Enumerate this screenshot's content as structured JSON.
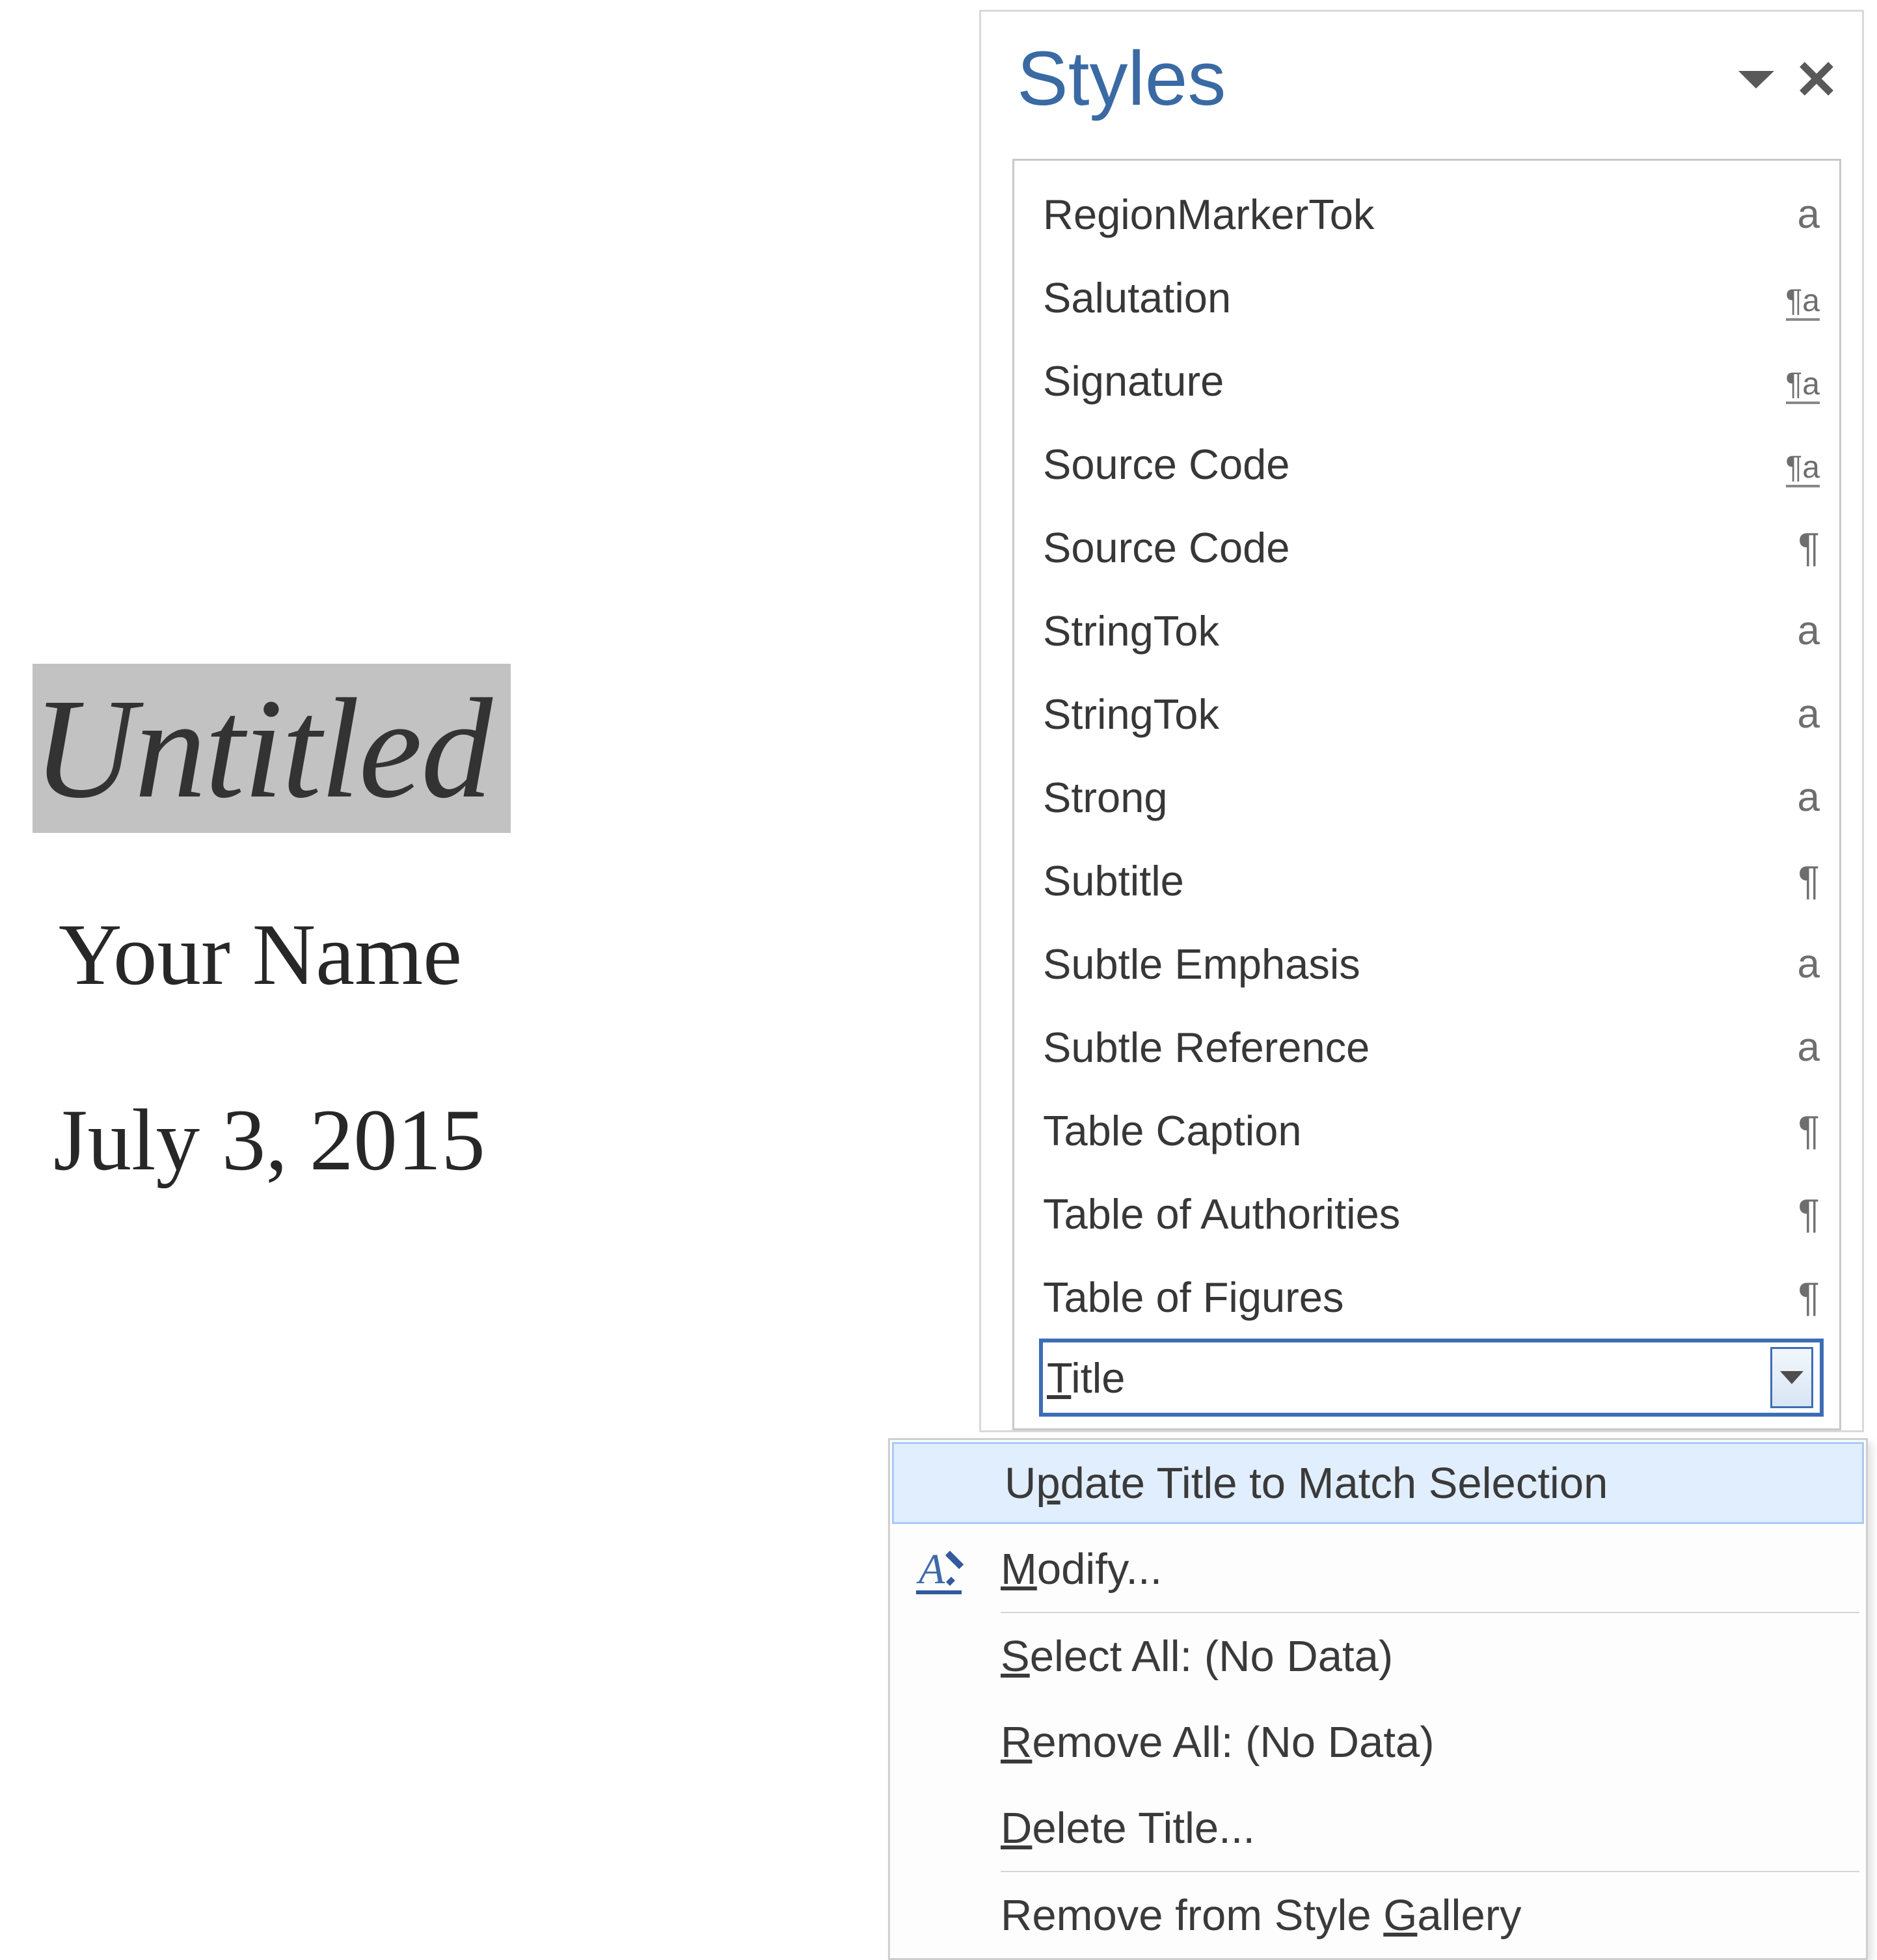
{
  "document": {
    "title_text": "Untitled",
    "author_text": "Your Name",
    "date_text": "July 3, 2015"
  },
  "pane": {
    "title": "Styles",
    "styles": [
      {
        "name": "RegionMarkerTok",
        "indicator": "a"
      },
      {
        "name": "Salutation",
        "indicator": "pilcrow-a"
      },
      {
        "name": "Signature",
        "indicator": "pilcrow-a"
      },
      {
        "name": "Source Code",
        "indicator": "pilcrow-a"
      },
      {
        "name": "Source Code",
        "indicator": "pilcrow"
      },
      {
        "name": "StringTok",
        "indicator": "a"
      },
      {
        "name": "StringTok",
        "indicator": "a"
      },
      {
        "name": "Strong",
        "indicator": "a"
      },
      {
        "name": "Subtitle",
        "indicator": "pilcrow"
      },
      {
        "name": "Subtle Emphasis",
        "indicator": "a"
      },
      {
        "name": "Subtle Reference",
        "indicator": "a"
      },
      {
        "name": "Table Caption",
        "indicator": "pilcrow"
      },
      {
        "name": "Table of Authorities",
        "indicator": "pilcrow"
      },
      {
        "name": "Table of Figures",
        "indicator": "pilcrow"
      }
    ],
    "selected": {
      "name_pre": "",
      "name_accel": "T",
      "name_post": "itle"
    }
  },
  "menu": {
    "update_pre": "U",
    "update_accel": "p",
    "update_post": "date Title to Match Selection",
    "modify_pre": "",
    "modify_accel": "M",
    "modify_post": "odify...",
    "select_pre": "",
    "select_accel": "S",
    "select_post": "elect All: (No Data)",
    "remove_pre": "",
    "remove_accel": "R",
    "remove_post": "emove All: (No Data)",
    "delete_pre": "",
    "delete_accel": "D",
    "delete_post": "elete Title...",
    "gallery_pre": "Remove from Style ",
    "gallery_accel": "G",
    "gallery_post": "allery"
  }
}
